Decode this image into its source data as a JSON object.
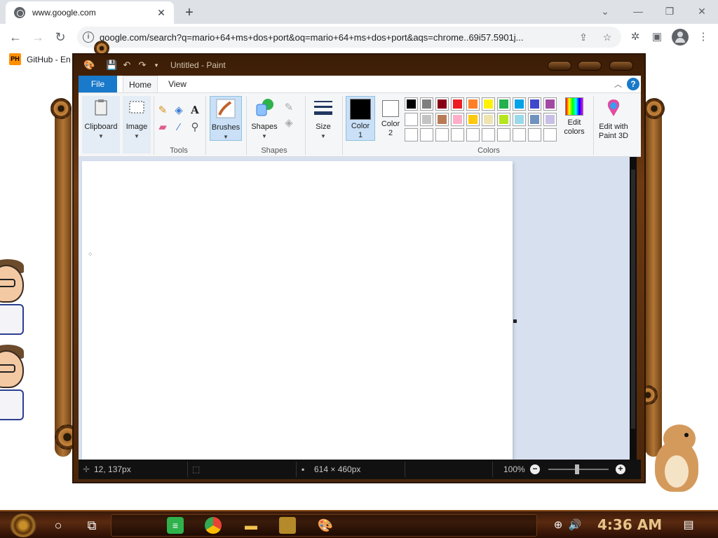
{
  "browser": {
    "tab_title": "www.google.com",
    "tab_close": "✕",
    "new_tab": "+",
    "window_controls": [
      "⌄",
      "—",
      "❐",
      "✕"
    ],
    "url": "google.com/search?q=mario+64+ms+dos+port&oq=mario+64+ms+dos+port&aqs=chrome..69i57.5901j...",
    "bookmark_icon_text": "PH",
    "bookmark_label": "GitHub - En"
  },
  "paint": {
    "window_title": "Untitled - Paint",
    "tabs": {
      "file": "File",
      "home": "Home",
      "view": "View"
    },
    "help": "?",
    "groups": {
      "clipboard": "Clipboard",
      "image": "Image",
      "tools": "Tools",
      "brushes": "Brushes",
      "shapes": "Shapes",
      "shapes_group": "Shapes",
      "size": "Size",
      "color1_line1": "Color",
      "color1_line2": "1",
      "color2_line1": "Color",
      "color2_line2": "2",
      "colors": "Colors",
      "edit_colors_line1": "Edit",
      "edit_colors_line2": "colors",
      "paint3d_line1": "Edit with",
      "paint3d_line2": "Paint 3D"
    },
    "palette_row1": [
      "#000000",
      "#7f7f7f",
      "#880015",
      "#ed1c24",
      "#ff7f27",
      "#fff200",
      "#22b14c",
      "#00a2e8",
      "#3f48cc",
      "#a349a4"
    ],
    "palette_row2": [
      "#ffffff",
      "#c3c3c3",
      "#b97a57",
      "#ffaec9",
      "#ffc90e",
      "#efe4b0",
      "#b5e61d",
      "#99d9ea",
      "#7092be",
      "#c8bfe7"
    ],
    "color1": "#000000",
    "color2": "#ffffff",
    "status": {
      "cursor_pos": "12, 137px",
      "canvas_size": "614 × 460px",
      "zoom": "100%",
      "zoom_minus": "−",
      "zoom_plus": "+"
    }
  },
  "taskbar": {
    "clock": "4:36 AM"
  }
}
